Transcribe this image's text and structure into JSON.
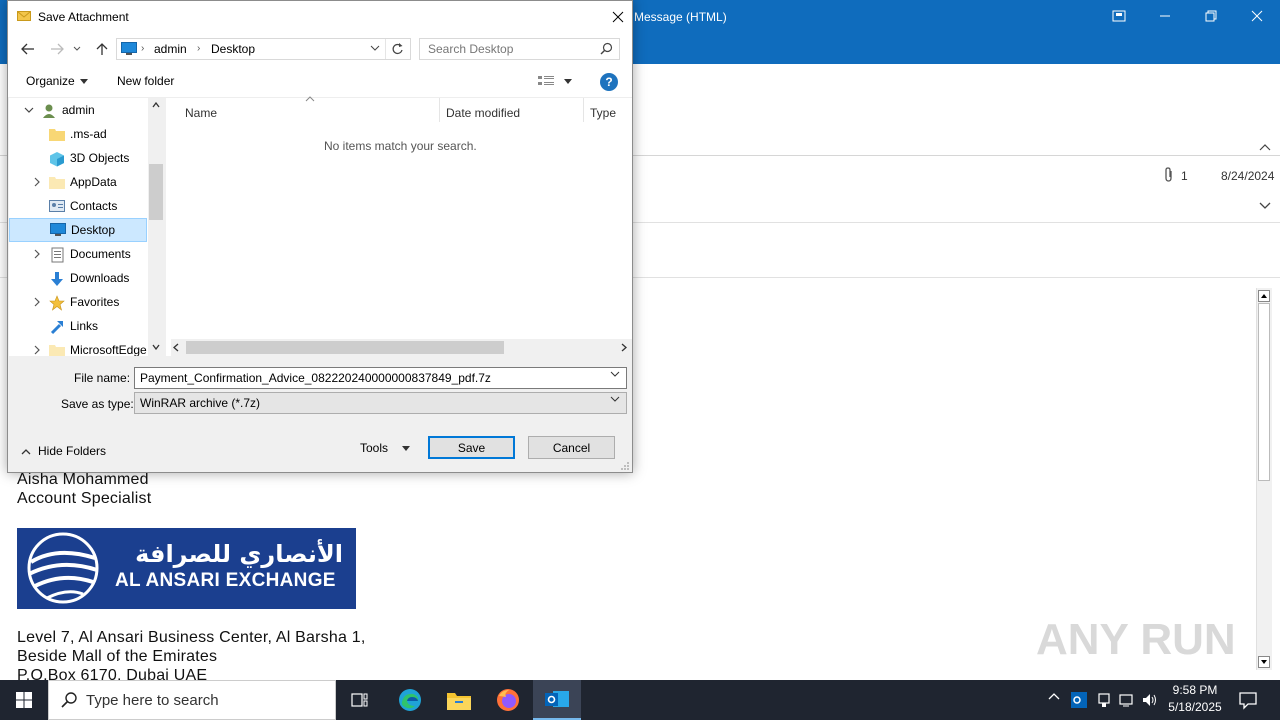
{
  "outlook": {
    "window_title": "Message (HTML)",
    "attachment_count": "1",
    "date": "8/24/2024",
    "signature": {
      "name": "Aisha Mohammed",
      "title": "Account Specialist",
      "logo_arabic": "الأنصاري للصرافة",
      "logo_english": "AL ANSARI EXCHANGE",
      "address_line1": "Level 7, Al Ansari Business Center, Al Barsha 1,",
      "address_line2": "Beside Mall of the Emirates",
      "address_line3": "P.O.Box 6170, Dubai UAE"
    },
    "watermark": "ANY RUN",
    "colors": {
      "titlebar": "#0f6cbd",
      "logo_bg": "#1b3f8f"
    }
  },
  "dialog": {
    "title": "Save Attachment",
    "breadcrumb": [
      "admin",
      "Desktop"
    ],
    "search_placeholder": "Search Desktop",
    "toolbar": {
      "organize": "Organize",
      "new_folder": "New folder"
    },
    "tree": [
      {
        "label": "admin",
        "icon": "user-folder-icon",
        "expanded": true
      },
      {
        "label": ".ms-ad",
        "icon": "folder-icon"
      },
      {
        "label": "3D Objects",
        "icon": "3d-objects-icon"
      },
      {
        "label": "AppData",
        "icon": "folder-icon"
      },
      {
        "label": "Contacts",
        "icon": "contacts-icon"
      },
      {
        "label": "Desktop",
        "icon": "desktop-icon",
        "selected": true
      },
      {
        "label": "Documents",
        "icon": "documents-icon"
      },
      {
        "label": "Downloads",
        "icon": "downloads-icon"
      },
      {
        "label": "Favorites",
        "icon": "favorites-icon"
      },
      {
        "label": "Links",
        "icon": "links-icon"
      },
      {
        "label": "MicrosoftEdge",
        "icon": "folder-icon"
      }
    ],
    "columns": {
      "name": "Name",
      "date_modified": "Date modified",
      "type": "Type"
    },
    "empty_message": "No items match your search.",
    "file_name_label": "File name:",
    "file_name_value": "Payment_Confirmation_Advice_082220240000000837849_pdf.7z",
    "save_as_type_label": "Save as type:",
    "save_as_type_value": "WinRAR archive (*.7z)",
    "hide_folders": "Hide Folders",
    "tools": "Tools",
    "save": "Save",
    "cancel": "Cancel"
  },
  "taskbar": {
    "search_placeholder": "Type here to search",
    "time": "9:58 PM",
    "date": "5/18/2025"
  }
}
